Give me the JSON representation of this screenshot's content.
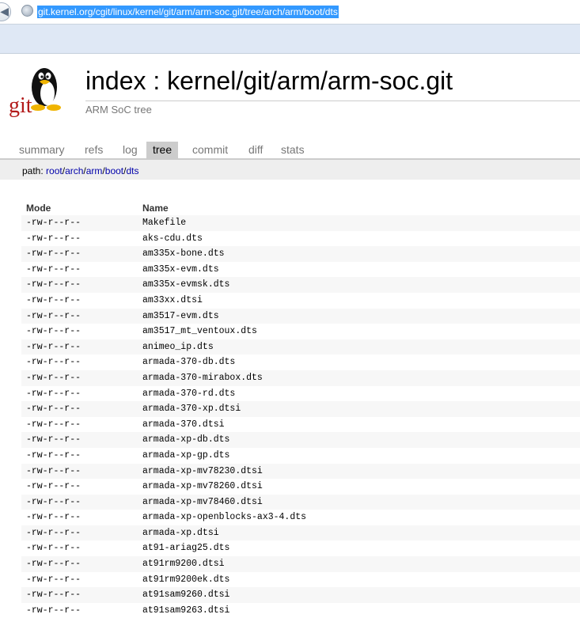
{
  "browser": {
    "back_icon": "back-arrow-icon",
    "url": "git.kernel.org/cgit/linux/kernel/git/arm/arm-soc.git/tree/arch/arm/boot/dts"
  },
  "header": {
    "logo_text": "git",
    "title": "index : kernel/git/arm/arm-soc.git",
    "description": "ARM SoC tree"
  },
  "tabs": [
    "summary",
    "refs",
    "log",
    "tree",
    "commit",
    "diff",
    "stats"
  ],
  "active_tab": "tree",
  "path": {
    "label": "path: ",
    "segments": [
      "root",
      "arch",
      "arm",
      "boot",
      "dts"
    ],
    "separator": "/"
  },
  "table": {
    "columns": [
      "Mode",
      "Name"
    ],
    "rows": [
      {
        "mode": "-rw-r--r--",
        "name": "Makefile"
      },
      {
        "mode": "-rw-r--r--",
        "name": "aks-cdu.dts"
      },
      {
        "mode": "-rw-r--r--",
        "name": "am335x-bone.dts"
      },
      {
        "mode": "-rw-r--r--",
        "name": "am335x-evm.dts"
      },
      {
        "mode": "-rw-r--r--",
        "name": "am335x-evmsk.dts"
      },
      {
        "mode": "-rw-r--r--",
        "name": "am33xx.dtsi"
      },
      {
        "mode": "-rw-r--r--",
        "name": "am3517-evm.dts"
      },
      {
        "mode": "-rw-r--r--",
        "name": "am3517_mt_ventoux.dts"
      },
      {
        "mode": "-rw-r--r--",
        "name": "animeo_ip.dts"
      },
      {
        "mode": "-rw-r--r--",
        "name": "armada-370-db.dts"
      },
      {
        "mode": "-rw-r--r--",
        "name": "armada-370-mirabox.dts"
      },
      {
        "mode": "-rw-r--r--",
        "name": "armada-370-rd.dts"
      },
      {
        "mode": "-rw-r--r--",
        "name": "armada-370-xp.dtsi"
      },
      {
        "mode": "-rw-r--r--",
        "name": "armada-370.dtsi"
      },
      {
        "mode": "-rw-r--r--",
        "name": "armada-xp-db.dts"
      },
      {
        "mode": "-rw-r--r--",
        "name": "armada-xp-gp.dts"
      },
      {
        "mode": "-rw-r--r--",
        "name": "armada-xp-mv78230.dtsi"
      },
      {
        "mode": "-rw-r--r--",
        "name": "armada-xp-mv78260.dtsi"
      },
      {
        "mode": "-rw-r--r--",
        "name": "armada-xp-mv78460.dtsi"
      },
      {
        "mode": "-rw-r--r--",
        "name": "armada-xp-openblocks-ax3-4.dts"
      },
      {
        "mode": "-rw-r--r--",
        "name": "armada-xp.dtsi"
      },
      {
        "mode": "-rw-r--r--",
        "name": "at91-ariag25.dts"
      },
      {
        "mode": "-rw-r--r--",
        "name": "at91rm9200.dtsi"
      },
      {
        "mode": "-rw-r--r--",
        "name": "at91rm9200ek.dts"
      },
      {
        "mode": "-rw-r--r--",
        "name": "at91sam9260.dtsi"
      },
      {
        "mode": "-rw-r--r--",
        "name": "at91sam9263.dtsi"
      }
    ]
  }
}
